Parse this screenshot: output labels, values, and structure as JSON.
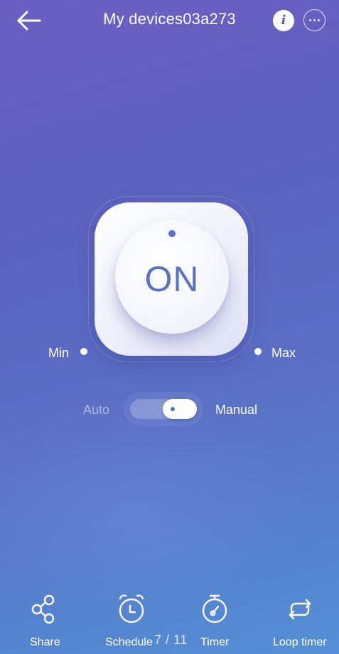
{
  "header": {
    "title": "My devices03a273",
    "back_icon": "arrow-left-icon",
    "info_icon": "info-icon",
    "info_glyph": "i",
    "more_icon": "more-horizontal-icon"
  },
  "control": {
    "power_state": "ON",
    "min_label": "Min",
    "max_label": "Max",
    "accent_color": "#5b70c6"
  },
  "mode": {
    "auto_label": "Auto",
    "manual_label": "Manual",
    "selected": "Manual"
  },
  "bottom_bar": {
    "share": {
      "label": "Share",
      "icon": "share-icon"
    },
    "schedule": {
      "label": "Schedule",
      "icon": "alarm-clock-icon"
    },
    "timer": {
      "label": "Timer",
      "icon": "stopwatch-icon"
    },
    "loop_timer": {
      "label": "Loop timer",
      "icon": "loop-icon"
    }
  },
  "page_indicator": "7 / 11",
  "colors": {
    "background_top": "#6c5fc3",
    "background_bottom": "#5590d6",
    "text": "#ffffff"
  }
}
